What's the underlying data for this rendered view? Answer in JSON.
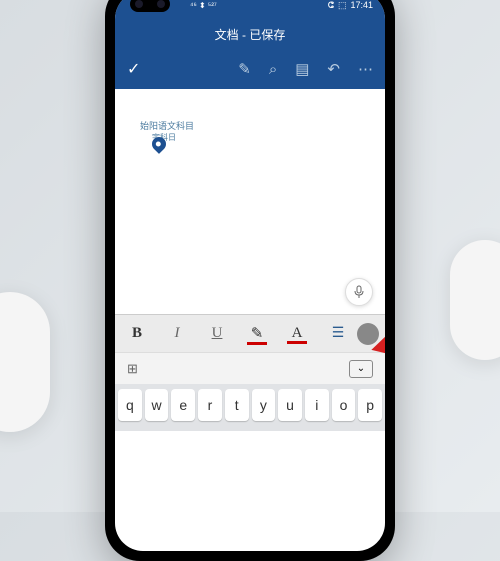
{
  "status": {
    "network": "⁴⁶ ⬍ ⁵²⁷",
    "bluetooth": "ⵛ",
    "battery": "⬚",
    "time": "17:41"
  },
  "header": {
    "title": "文档 - 已保存"
  },
  "toolbar": {
    "check": "✓",
    "pen": "✎",
    "search": "⌕",
    "doc": "▤",
    "undo": "↶",
    "more": "⋯"
  },
  "document": {
    "line1": "始阳语文科目",
    "line2": "宇科日"
  },
  "mic": "⏺",
  "format": {
    "bold": "B",
    "italic": "I",
    "underline": "U",
    "highlight": "✎",
    "color": "A",
    "list": "☰"
  },
  "keyboard_top": {
    "grid": "⊞",
    "dismiss": "⌄"
  },
  "keyboard": {
    "row1": [
      "q",
      "w",
      "e",
      "r",
      "t",
      "y",
      "u",
      "i",
      "o",
      "p"
    ]
  }
}
